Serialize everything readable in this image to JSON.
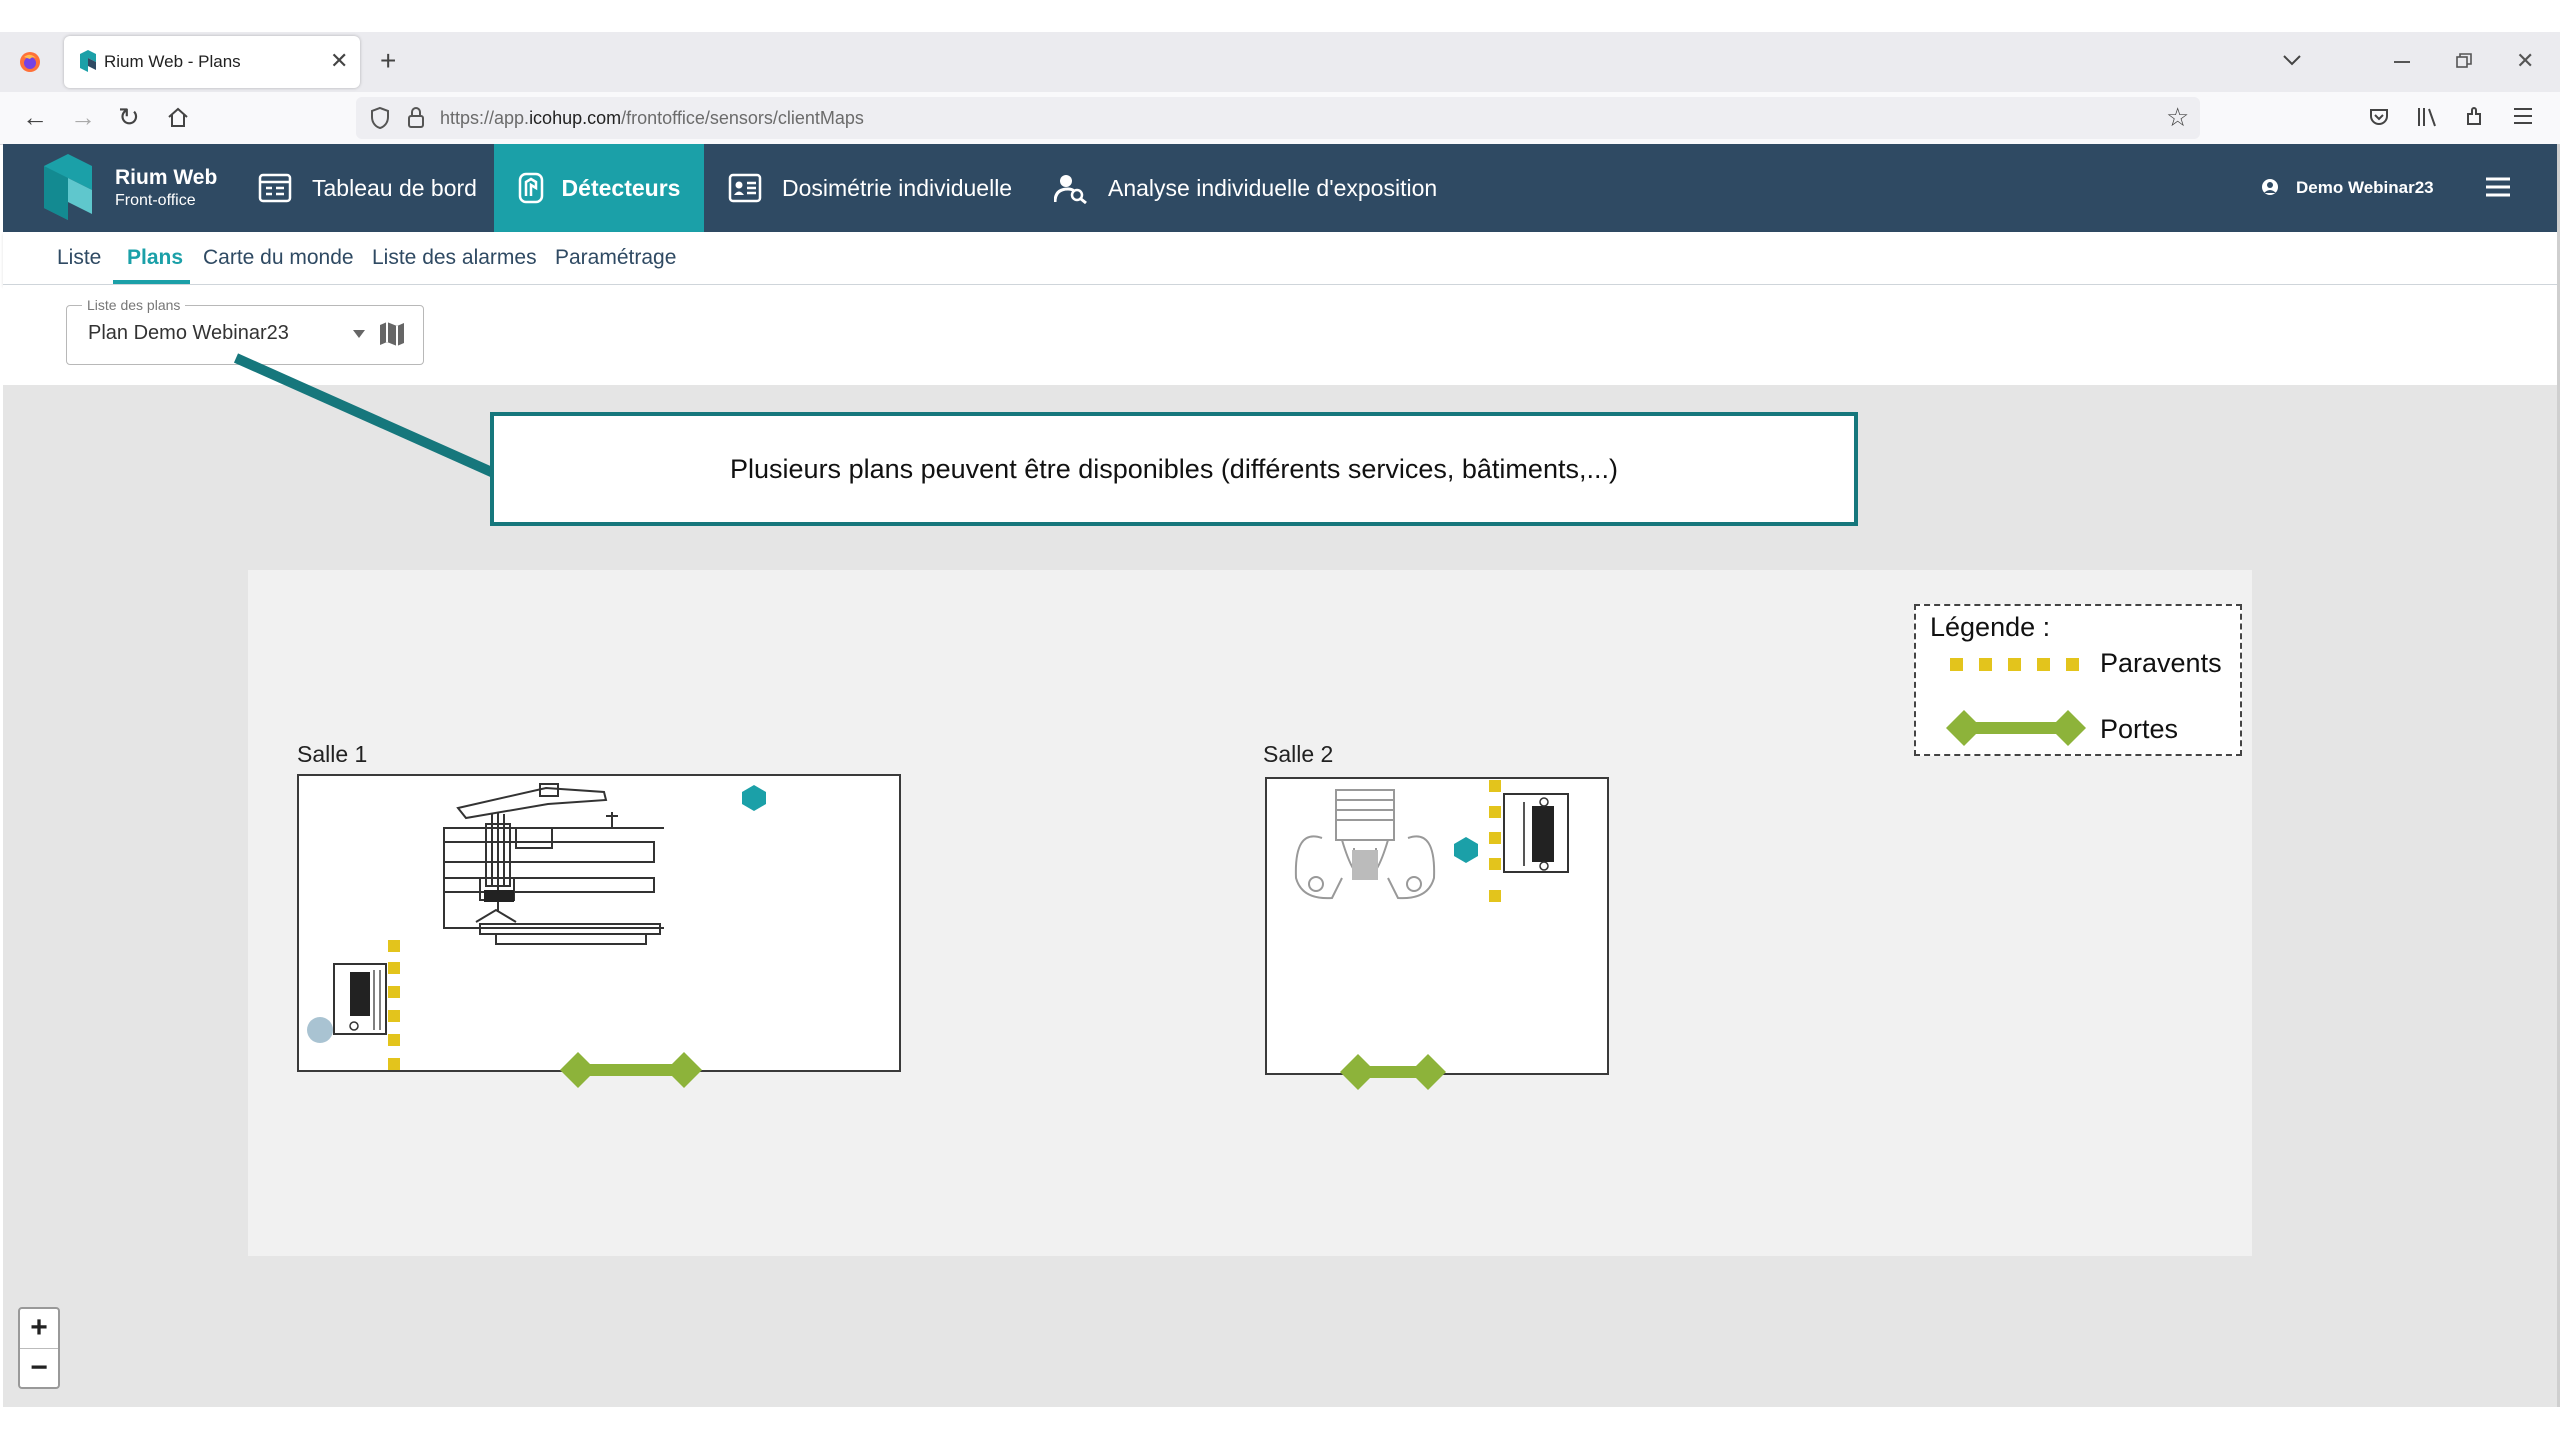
{
  "browser": {
    "tab_title": "Rium Web - Plans",
    "new_tab": "+",
    "url_prefix": "https://app.",
    "url_domain": "icohup.com",
    "url_path": "/frontoffice/sensors/clientMaps"
  },
  "app": {
    "brand_name": "Rium Web",
    "brand_sub": "Front-office",
    "nav": [
      {
        "label": "Tableau de bord",
        "icon": "dashboard-icon"
      },
      {
        "label": "Détecteurs",
        "icon": "detector-icon",
        "active": true
      },
      {
        "label": "Dosimétrie individuelle",
        "icon": "id-card-icon"
      },
      {
        "label": "Analyse individuelle d'exposition",
        "icon": "person-search-icon"
      }
    ],
    "user": "Demo Webinar23"
  },
  "subnav": [
    {
      "label": "Liste"
    },
    {
      "label": "Plans",
      "active": true
    },
    {
      "label": "Carte du monde"
    },
    {
      "label": "Liste des alarmes"
    },
    {
      "label": "Paramétrage"
    }
  ],
  "plan_select": {
    "legend": "Liste des plans",
    "value": "Plan Demo Webinar23"
  },
  "callout": {
    "text": "Plusieurs plans peuvent être disponibles (différents services, bâtiments,...)"
  },
  "map": {
    "rooms": [
      {
        "label": "Salle 1"
      },
      {
        "label": "Salle 2"
      }
    ],
    "legend": {
      "title": "Légende :",
      "items": [
        {
          "label": "Paravents",
          "color": "#e3c41c"
        },
        {
          "label": "Portes",
          "color": "#8db33a"
        }
      ]
    },
    "sensor_color": "#1ba0a8",
    "sensor_inactive_color": "#a9c3d2"
  },
  "zoom": {
    "in": "+",
    "out": "−"
  },
  "colors": {
    "header": "#2f4a63",
    "accent": "#1ba0a8",
    "callout_border": "#16777c"
  }
}
